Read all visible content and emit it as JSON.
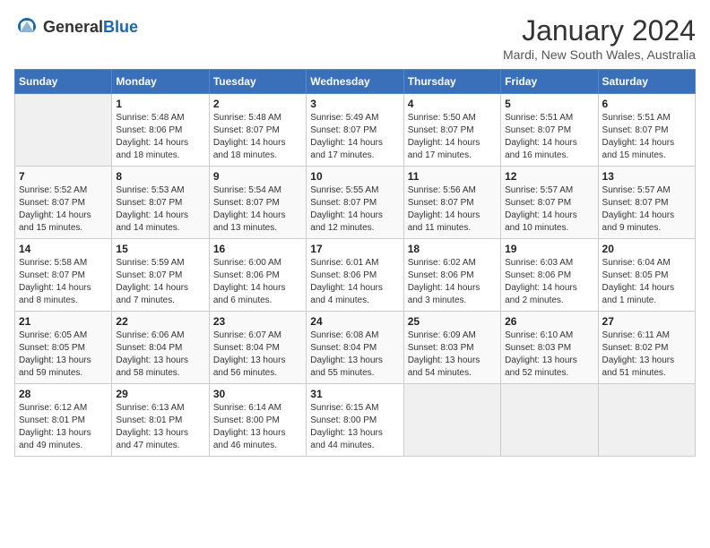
{
  "header": {
    "logo": {
      "text_general": "General",
      "text_blue": "Blue"
    },
    "title": "January 2024",
    "location": "Mardi, New South Wales, Australia"
  },
  "weekdays": [
    "Sunday",
    "Monday",
    "Tuesday",
    "Wednesday",
    "Thursday",
    "Friday",
    "Saturday"
  ],
  "weeks": [
    [
      {
        "day": "",
        "info": ""
      },
      {
        "day": "1",
        "info": "Sunrise: 5:48 AM\nSunset: 8:06 PM\nDaylight: 14 hours\nand 18 minutes."
      },
      {
        "day": "2",
        "info": "Sunrise: 5:48 AM\nSunset: 8:07 PM\nDaylight: 14 hours\nand 18 minutes."
      },
      {
        "day": "3",
        "info": "Sunrise: 5:49 AM\nSunset: 8:07 PM\nDaylight: 14 hours\nand 17 minutes."
      },
      {
        "day": "4",
        "info": "Sunrise: 5:50 AM\nSunset: 8:07 PM\nDaylight: 14 hours\nand 17 minutes."
      },
      {
        "day": "5",
        "info": "Sunrise: 5:51 AM\nSunset: 8:07 PM\nDaylight: 14 hours\nand 16 minutes."
      },
      {
        "day": "6",
        "info": "Sunrise: 5:51 AM\nSunset: 8:07 PM\nDaylight: 14 hours\nand 15 minutes."
      }
    ],
    [
      {
        "day": "7",
        "info": "Sunrise: 5:52 AM\nSunset: 8:07 PM\nDaylight: 14 hours\nand 15 minutes."
      },
      {
        "day": "8",
        "info": "Sunrise: 5:53 AM\nSunset: 8:07 PM\nDaylight: 14 hours\nand 14 minutes."
      },
      {
        "day": "9",
        "info": "Sunrise: 5:54 AM\nSunset: 8:07 PM\nDaylight: 14 hours\nand 13 minutes."
      },
      {
        "day": "10",
        "info": "Sunrise: 5:55 AM\nSunset: 8:07 PM\nDaylight: 14 hours\nand 12 minutes."
      },
      {
        "day": "11",
        "info": "Sunrise: 5:56 AM\nSunset: 8:07 PM\nDaylight: 14 hours\nand 11 minutes."
      },
      {
        "day": "12",
        "info": "Sunrise: 5:57 AM\nSunset: 8:07 PM\nDaylight: 14 hours\nand 10 minutes."
      },
      {
        "day": "13",
        "info": "Sunrise: 5:57 AM\nSunset: 8:07 PM\nDaylight: 14 hours\nand 9 minutes."
      }
    ],
    [
      {
        "day": "14",
        "info": "Sunrise: 5:58 AM\nSunset: 8:07 PM\nDaylight: 14 hours\nand 8 minutes."
      },
      {
        "day": "15",
        "info": "Sunrise: 5:59 AM\nSunset: 8:07 PM\nDaylight: 14 hours\nand 7 minutes."
      },
      {
        "day": "16",
        "info": "Sunrise: 6:00 AM\nSunset: 8:06 PM\nDaylight: 14 hours\nand 6 minutes."
      },
      {
        "day": "17",
        "info": "Sunrise: 6:01 AM\nSunset: 8:06 PM\nDaylight: 14 hours\nand 4 minutes."
      },
      {
        "day": "18",
        "info": "Sunrise: 6:02 AM\nSunset: 8:06 PM\nDaylight: 14 hours\nand 3 minutes."
      },
      {
        "day": "19",
        "info": "Sunrise: 6:03 AM\nSunset: 8:06 PM\nDaylight: 14 hours\nand 2 minutes."
      },
      {
        "day": "20",
        "info": "Sunrise: 6:04 AM\nSunset: 8:05 PM\nDaylight: 14 hours\nand 1 minute."
      }
    ],
    [
      {
        "day": "21",
        "info": "Sunrise: 6:05 AM\nSunset: 8:05 PM\nDaylight: 13 hours\nand 59 minutes."
      },
      {
        "day": "22",
        "info": "Sunrise: 6:06 AM\nSunset: 8:04 PM\nDaylight: 13 hours\nand 58 minutes."
      },
      {
        "day": "23",
        "info": "Sunrise: 6:07 AM\nSunset: 8:04 PM\nDaylight: 13 hours\nand 56 minutes."
      },
      {
        "day": "24",
        "info": "Sunrise: 6:08 AM\nSunset: 8:04 PM\nDaylight: 13 hours\nand 55 minutes."
      },
      {
        "day": "25",
        "info": "Sunrise: 6:09 AM\nSunset: 8:03 PM\nDaylight: 13 hours\nand 54 minutes."
      },
      {
        "day": "26",
        "info": "Sunrise: 6:10 AM\nSunset: 8:03 PM\nDaylight: 13 hours\nand 52 minutes."
      },
      {
        "day": "27",
        "info": "Sunrise: 6:11 AM\nSunset: 8:02 PM\nDaylight: 13 hours\nand 51 minutes."
      }
    ],
    [
      {
        "day": "28",
        "info": "Sunrise: 6:12 AM\nSunset: 8:01 PM\nDaylight: 13 hours\nand 49 minutes."
      },
      {
        "day": "29",
        "info": "Sunrise: 6:13 AM\nSunset: 8:01 PM\nDaylight: 13 hours\nand 47 minutes."
      },
      {
        "day": "30",
        "info": "Sunrise: 6:14 AM\nSunset: 8:00 PM\nDaylight: 13 hours\nand 46 minutes."
      },
      {
        "day": "31",
        "info": "Sunrise: 6:15 AM\nSunset: 8:00 PM\nDaylight: 13 hours\nand 44 minutes."
      },
      {
        "day": "",
        "info": ""
      },
      {
        "day": "",
        "info": ""
      },
      {
        "day": "",
        "info": ""
      }
    ]
  ]
}
